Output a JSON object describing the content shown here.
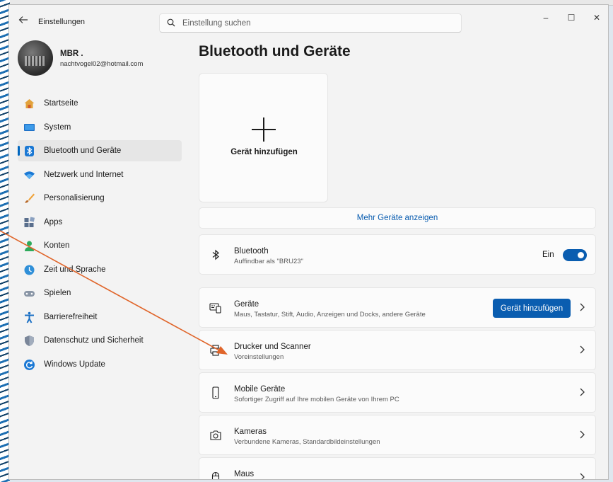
{
  "window": {
    "title": "Einstellungen",
    "back_icon": "back-arrow-icon",
    "controls": {
      "minimize": "–",
      "maximize": "☐",
      "close": "✕"
    }
  },
  "search": {
    "placeholder": "Einstellung suchen"
  },
  "user": {
    "name": "MBR .",
    "email": "nachtvogel02@hotmail.com"
  },
  "sidebar": {
    "items": [
      {
        "label": "Startseite",
        "icon": "home-icon"
      },
      {
        "label": "System",
        "icon": "system-display-icon"
      },
      {
        "label": "Bluetooth und Geräte",
        "icon": "bluetooth-icon",
        "active": true
      },
      {
        "label": "Netzwerk und Internet",
        "icon": "wifi-icon"
      },
      {
        "label": "Personalisierung",
        "icon": "brush-icon"
      },
      {
        "label": "Apps",
        "icon": "apps-icon"
      },
      {
        "label": "Konten",
        "icon": "account-icon"
      },
      {
        "label": "Zeit und Sprache",
        "icon": "time-language-icon"
      },
      {
        "label": "Spielen",
        "icon": "gamepad-icon"
      },
      {
        "label": "Barrierefreiheit",
        "icon": "accessibility-icon"
      },
      {
        "label": "Datenschutz und Sicherheit",
        "icon": "shield-icon"
      },
      {
        "label": "Windows Update",
        "icon": "update-icon"
      }
    ]
  },
  "main": {
    "title": "Bluetooth und Geräte",
    "add_tile": {
      "label": "Gerät hinzufügen"
    },
    "more_devices": "Mehr Geräte anzeigen",
    "bluetooth": {
      "title": "Bluetooth",
      "subtitle": "Auffindbar als \"BRU23\"",
      "state_label": "Ein",
      "enabled": true
    },
    "cards": [
      {
        "title": "Geräte",
        "subtitle": "Maus, Tastatur, Stift, Audio, Anzeigen und Docks, andere Geräte",
        "button": "Gerät hinzufügen",
        "icon": "devices-icon"
      },
      {
        "title": "Drucker und Scanner",
        "subtitle": "Voreinstellungen",
        "icon": "printer-icon"
      },
      {
        "title": "Mobile Geräte",
        "subtitle": "Sofortiger Zugriff auf Ihre mobilen Geräte von Ihrem PC",
        "icon": "phone-icon"
      },
      {
        "title": "Kameras",
        "subtitle": "Verbundene Kameras, Standardbildeinstellungen",
        "icon": "camera-icon"
      },
      {
        "title": "Maus",
        "subtitle": "",
        "icon": "mouse-icon"
      }
    ]
  },
  "colors": {
    "accent": "#0a5db0",
    "annotation_arrow": "#e0652a",
    "window_bg": "#f3f3f3",
    "card_bg": "#fbfbfb"
  }
}
